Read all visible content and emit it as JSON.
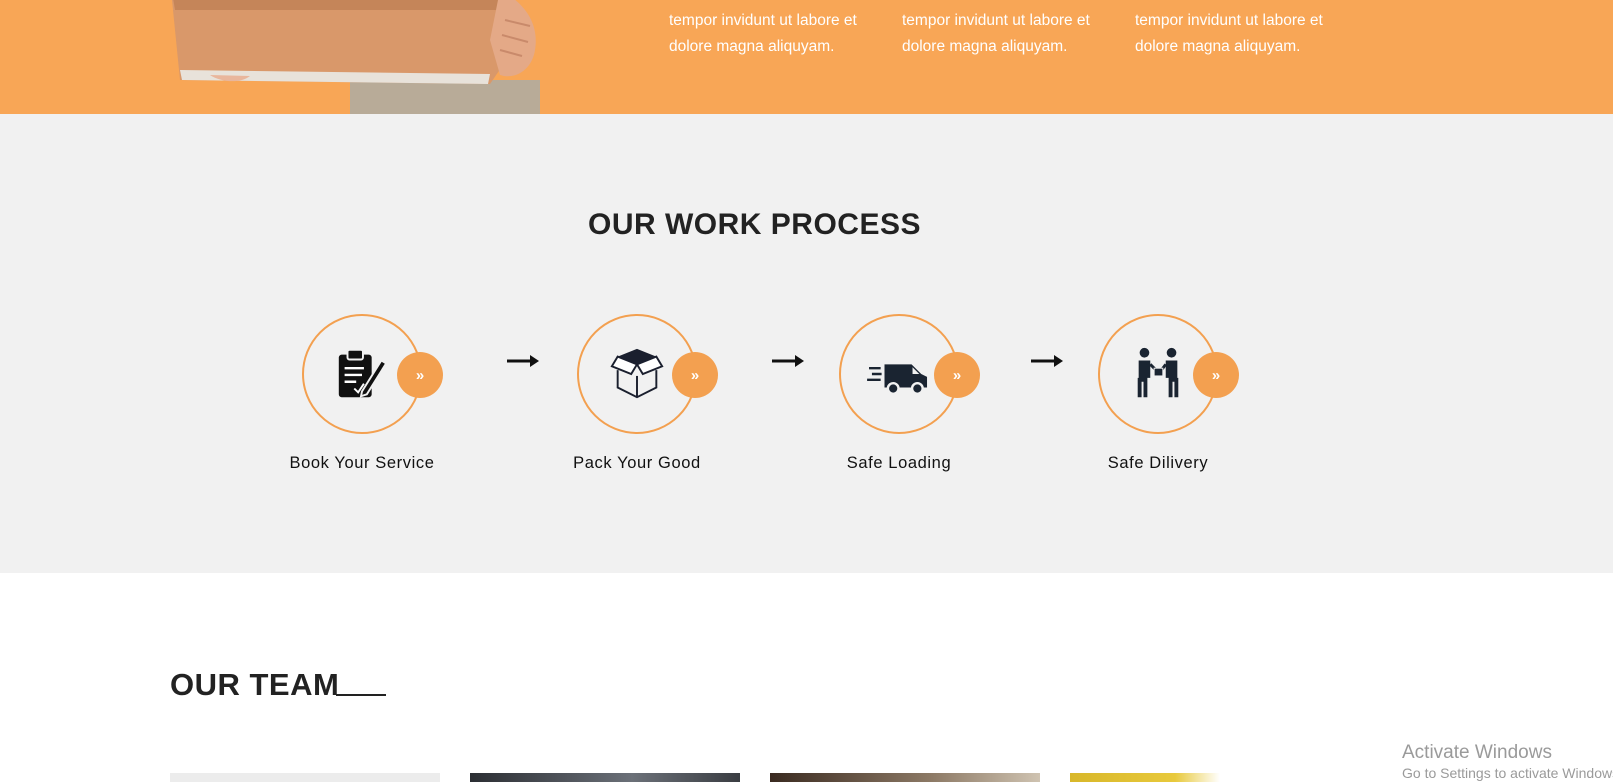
{
  "top_band": {
    "columns": [
      {
        "line1": "tempor invidunt ut labore et",
        "line2": "dolore magna aliquyam."
      },
      {
        "line1": "tempor invidunt ut labore et",
        "line2": "dolore magna aliquyam."
      },
      {
        "line1": "tempor invidunt ut labore et",
        "line2": "dolore magna aliquyam."
      }
    ]
  },
  "process": {
    "title": "OUR WORK PROCESS",
    "next_glyph": "»",
    "steps": [
      {
        "label": "Book Your Service",
        "icon": "clipboard-icon"
      },
      {
        "label": "Pack Your Good",
        "icon": "open-box-icon"
      },
      {
        "label": "Safe Loading",
        "icon": "delivery-van-icon"
      },
      {
        "label": "Safe Dilivery",
        "icon": "handover-icon"
      }
    ]
  },
  "team": {
    "title": "OUR TEAM"
  },
  "watermark": {
    "title": "Activate Windows",
    "subtitle": "Go to Settings to activate Windows."
  },
  "colors": {
    "accent": "#f3a050",
    "band": "#f8a656",
    "section_bg": "#f1f1f1",
    "heading": "#222222"
  }
}
